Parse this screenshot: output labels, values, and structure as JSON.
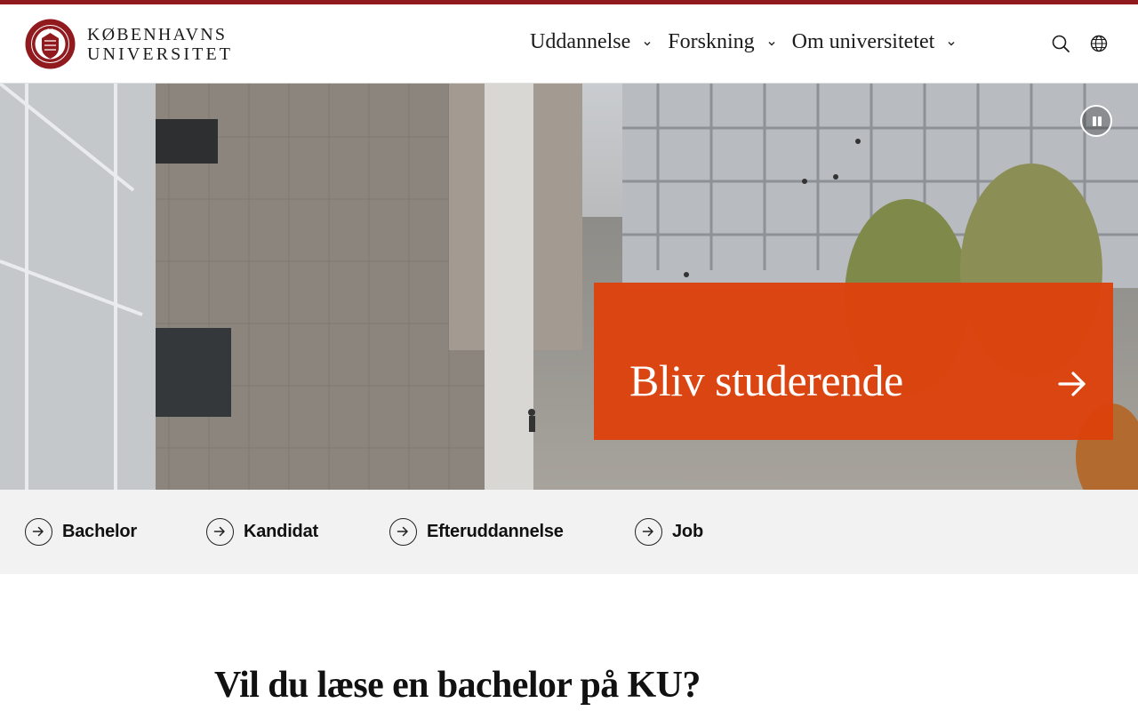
{
  "brand": {
    "line1": "KØBENHAVNS",
    "line2": "UNIVERSITET",
    "accent_color": "#901a1e"
  },
  "nav": {
    "items": [
      {
        "label": "Uddannelse",
        "icon": "chevron-down-icon"
      },
      {
        "label": "Forskning",
        "icon": "chevron-down-icon"
      },
      {
        "label": "Om universitetet",
        "icon": "chevron-down-icon"
      }
    ]
  },
  "header_icons": [
    "search-icon",
    "globe-icon"
  ],
  "hero": {
    "pause_icon": "pause-icon",
    "cta": {
      "label": "Bliv studerende",
      "icon": "arrow-right-icon",
      "color": "#dd420c"
    }
  },
  "quicklinks": [
    {
      "label": "Bachelor",
      "icon": "arrow-right-circle-icon"
    },
    {
      "label": "Kandidat",
      "icon": "arrow-right-circle-icon"
    },
    {
      "label": "Efteruddannelse",
      "icon": "arrow-right-circle-icon"
    },
    {
      "label": "Job",
      "icon": "arrow-right-circle-icon"
    }
  ],
  "section": {
    "title": "Vil du læse en bachelor på KU?"
  }
}
